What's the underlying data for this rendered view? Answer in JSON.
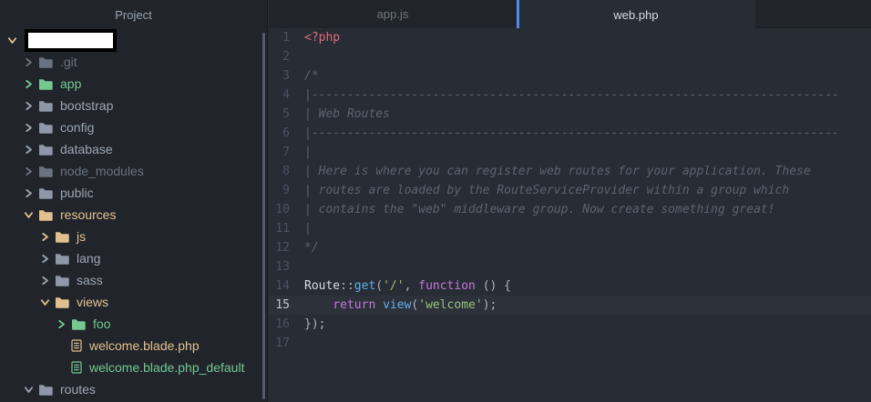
{
  "colors": {
    "editor_bg": "#282c34",
    "sidebar_bg": "#21252b",
    "active_line_bg": "#2c313a",
    "tab_accent_blue": "#4e8af7",
    "git_added": "#73c990",
    "git_modified": "#e2c08d",
    "git_ignored": "#6b727f",
    "tree_default": "#9da5b4",
    "syntax_tag": "#e06c75",
    "syntax_comment": "#5c6370",
    "syntax_keyword": "#c678dd",
    "syntax_function": "#61afef",
    "syntax_string": "#98c379"
  },
  "sidebar": {
    "header": "Project",
    "root": {
      "label_redacted": true,
      "expanded": true,
      "status": "modified"
    },
    "items": [
      {
        "label": ".git",
        "type": "folder",
        "depth": 1,
        "expanded": false,
        "status": "ignored"
      },
      {
        "label": "app",
        "type": "folder",
        "depth": 1,
        "expanded": false,
        "status": "added"
      },
      {
        "label": "bootstrap",
        "type": "folder",
        "depth": 1,
        "expanded": false,
        "status": "default"
      },
      {
        "label": "config",
        "type": "folder",
        "depth": 1,
        "expanded": false,
        "status": "default"
      },
      {
        "label": "database",
        "type": "folder",
        "depth": 1,
        "expanded": false,
        "status": "default"
      },
      {
        "label": "node_modules",
        "type": "folder",
        "depth": 1,
        "expanded": false,
        "status": "ignored"
      },
      {
        "label": "public",
        "type": "folder",
        "depth": 1,
        "expanded": false,
        "status": "default"
      },
      {
        "label": "resources",
        "type": "folder",
        "depth": 1,
        "expanded": true,
        "status": "modified"
      },
      {
        "label": "js",
        "type": "folder",
        "depth": 2,
        "expanded": false,
        "status": "modified"
      },
      {
        "label": "lang",
        "type": "folder",
        "depth": 2,
        "expanded": false,
        "status": "default"
      },
      {
        "label": "sass",
        "type": "folder",
        "depth": 2,
        "expanded": false,
        "status": "default"
      },
      {
        "label": "views",
        "type": "folder",
        "depth": 2,
        "expanded": true,
        "status": "modified"
      },
      {
        "label": "foo",
        "type": "folder",
        "depth": 3,
        "expanded": false,
        "status": "added"
      },
      {
        "label": "welcome.blade.php",
        "type": "file",
        "depth": 3,
        "status": "modified"
      },
      {
        "label": "welcome.blade.php_default",
        "type": "file",
        "depth": 3,
        "status": "added"
      },
      {
        "label": "routes",
        "type": "folder",
        "depth": 1,
        "expanded": true,
        "status": "default"
      }
    ]
  },
  "tabs": [
    {
      "label": "app.js",
      "active": false
    },
    {
      "label": "web.php",
      "active": true
    }
  ],
  "editor": {
    "active_line": 15,
    "lines": [
      {
        "num": 1,
        "tokens": [
          {
            "t": "<?php",
            "c": "tag"
          }
        ]
      },
      {
        "num": 2,
        "tokens": []
      },
      {
        "num": 3,
        "tokens": [
          {
            "t": "/*",
            "c": "comment"
          }
        ]
      },
      {
        "num": 4,
        "tokens": [
          {
            "t": "|--------------------------------------------------------------------------",
            "c": "comment"
          }
        ]
      },
      {
        "num": 5,
        "tokens": [
          {
            "t": "| Web Routes",
            "c": "comment"
          }
        ]
      },
      {
        "num": 6,
        "tokens": [
          {
            "t": "|--------------------------------------------------------------------------",
            "c": "comment"
          }
        ]
      },
      {
        "num": 7,
        "tokens": [
          {
            "t": "|",
            "c": "comment"
          }
        ]
      },
      {
        "num": 8,
        "tokens": [
          {
            "t": "| Here is where you can register web routes for your application. These",
            "c": "comment"
          }
        ]
      },
      {
        "num": 9,
        "tokens": [
          {
            "t": "| routes are loaded by the RouteServiceProvider within a group which",
            "c": "comment"
          }
        ]
      },
      {
        "num": 10,
        "tokens": [
          {
            "t": "| contains the \"web\" middleware group. Now create something great!",
            "c": "comment"
          }
        ]
      },
      {
        "num": 11,
        "tokens": [
          {
            "t": "|",
            "c": "comment"
          }
        ]
      },
      {
        "num": 12,
        "tokens": [
          {
            "t": "*/",
            "c": "comment"
          }
        ]
      },
      {
        "num": 13,
        "tokens": []
      },
      {
        "num": 14,
        "tokens": [
          {
            "t": "Route",
            "c": "ident"
          },
          {
            "t": "::",
            "c": "plain"
          },
          {
            "t": "get",
            "c": "func"
          },
          {
            "t": "(",
            "c": "plain"
          },
          {
            "t": "'/'",
            "c": "string"
          },
          {
            "t": ", ",
            "c": "plain"
          },
          {
            "t": "function",
            "c": "keyword"
          },
          {
            "t": " () {",
            "c": "plain"
          }
        ]
      },
      {
        "num": 15,
        "tokens": [
          {
            "t": "    ",
            "c": "plain"
          },
          {
            "t": "return",
            "c": "keyword"
          },
          {
            "t": " ",
            "c": "plain"
          },
          {
            "t": "view",
            "c": "func"
          },
          {
            "t": "(",
            "c": "plain"
          },
          {
            "t": "'welcome'",
            "c": "string"
          },
          {
            "t": ");",
            "c": "plain"
          }
        ]
      },
      {
        "num": 16,
        "tokens": [
          {
            "t": "});",
            "c": "plain"
          }
        ]
      },
      {
        "num": 17,
        "tokens": []
      }
    ]
  }
}
